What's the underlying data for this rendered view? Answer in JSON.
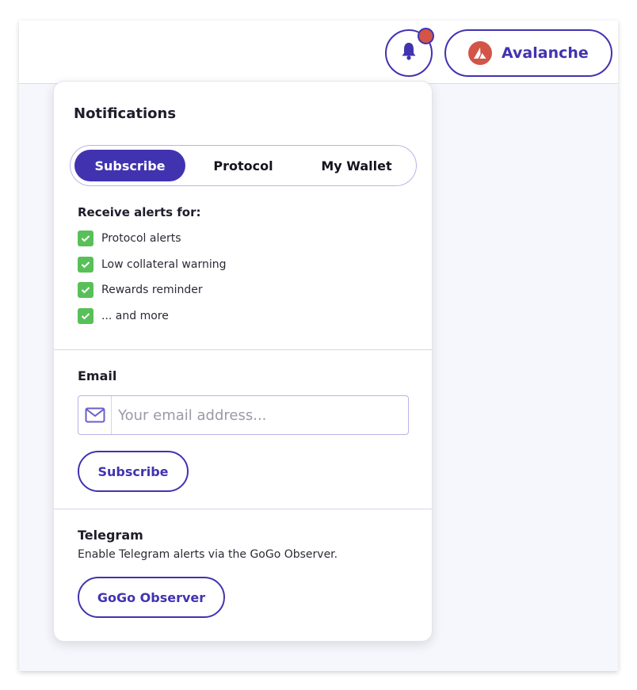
{
  "header": {
    "network_label": "Avalanche",
    "icons": {
      "bell": "bell-icon",
      "network_logo": "avalanche-logo-icon"
    },
    "colors": {
      "accent": "#4133b0",
      "notification_dot": "#d25548",
      "avalanche_red": "#d25548"
    }
  },
  "notifications": {
    "title": "Notifications",
    "tabs": [
      {
        "label": "Subscribe",
        "active": true
      },
      {
        "label": "Protocol",
        "active": false
      },
      {
        "label": "My Wallet",
        "active": false
      }
    ],
    "alerts_heading": "Receive alerts for:",
    "alerts": [
      {
        "label": "Protocol alerts",
        "checked": true
      },
      {
        "label": "Low collateral warning",
        "checked": true
      },
      {
        "label": "Rewards reminder",
        "checked": true
      },
      {
        "label": "... and more",
        "checked": true
      }
    ],
    "email": {
      "heading": "Email",
      "placeholder": "Your email address...",
      "value": "",
      "icon": "mail-icon",
      "button_label": "Subscribe"
    },
    "telegram": {
      "heading": "Telegram",
      "description": "Enable Telegram alerts via the GoGo Observer.",
      "button_label": "GoGo Observer"
    },
    "colors": {
      "check_green": "#58c058",
      "divider": "#d6d3f0"
    }
  }
}
